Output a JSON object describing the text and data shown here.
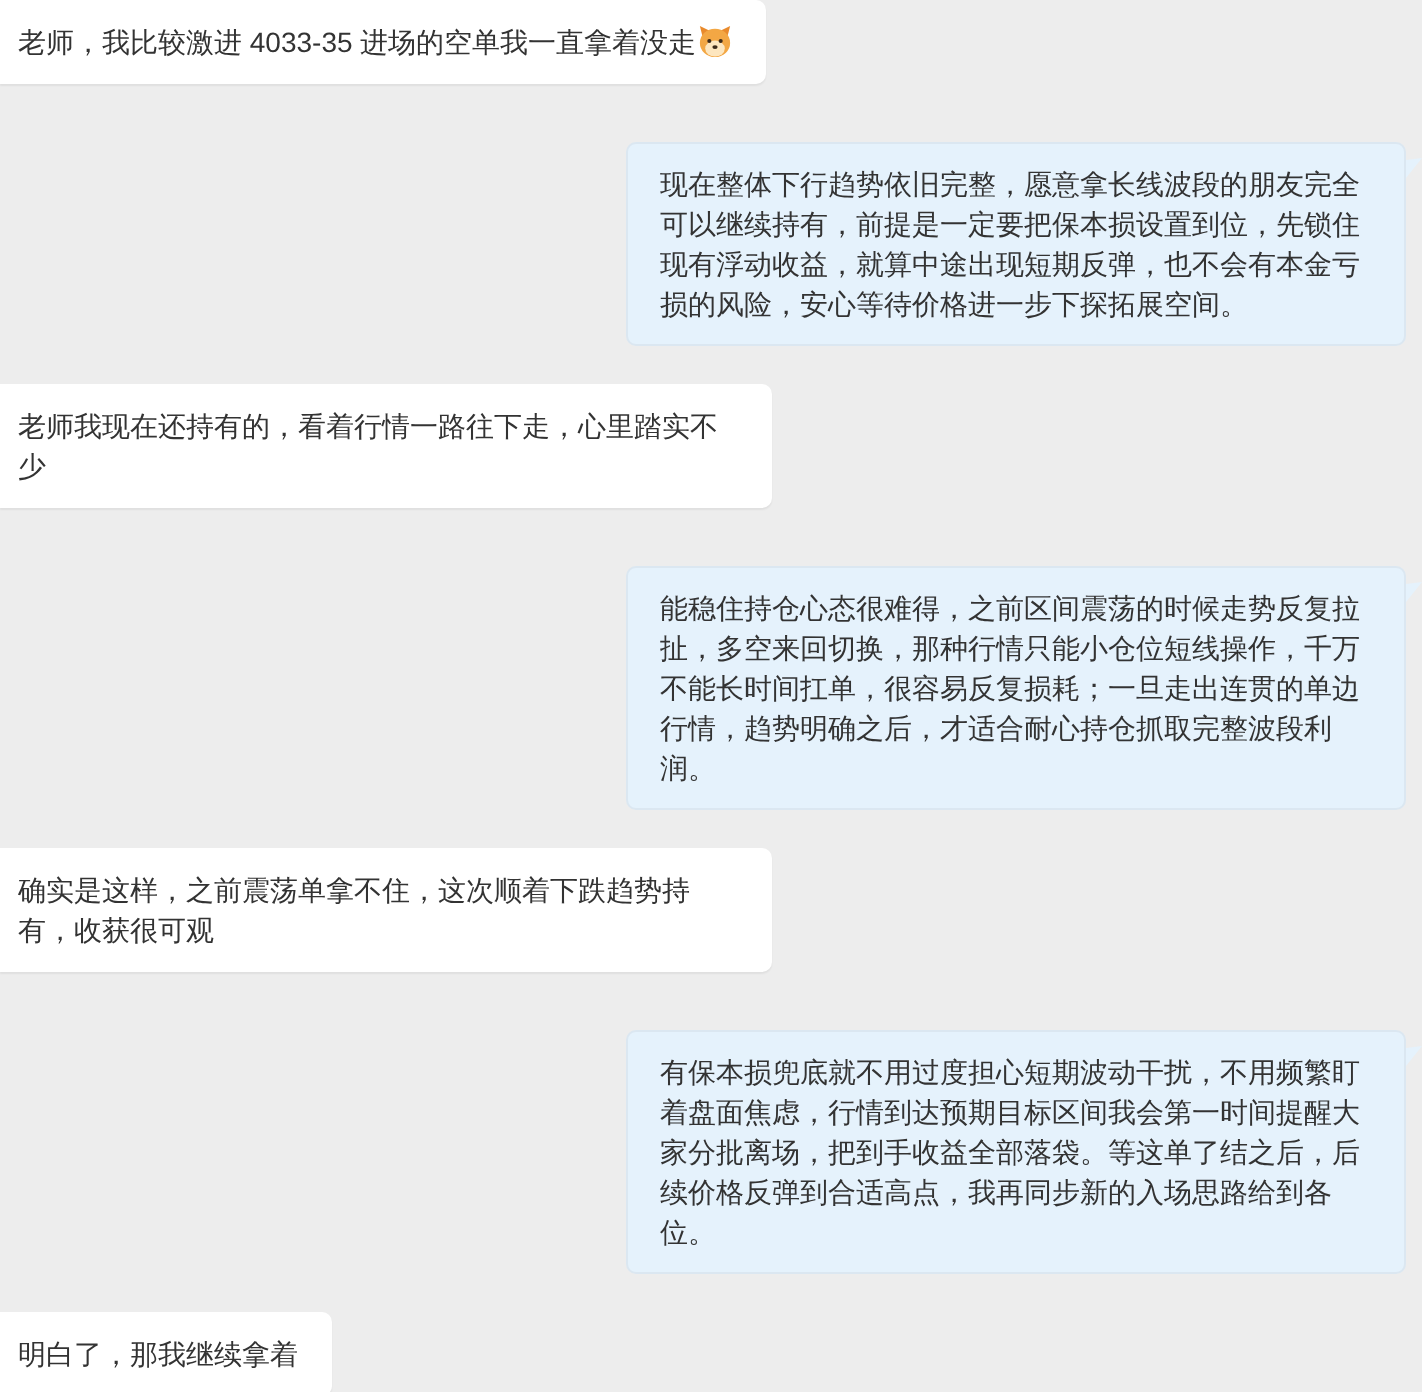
{
  "messages": [
    {
      "kind": "incoming",
      "text": "老师，我比较激进 4033-35 进场的空单我一直拿着没走",
      "has_emoji": true
    },
    {
      "kind": "outgoing",
      "text": "现在整体下行趋势依旧完整，愿意拿长线波段的朋友完全可以继续持有，前提是一定要把保本损设置到位，先锁住现有浮动收益，就算中途出现短期反弹，也不会有本金亏损的风险，安心等待价格进一步下探拓展空间。"
    },
    {
      "kind": "incoming",
      "text": "老师我现在还持有的，看着行情一路往下走，心里踏实不少"
    },
    {
      "kind": "outgoing",
      "text": "能稳住持仓心态很难得，之前区间震荡的时候走势反复拉扯，多空来回切换，那种行情只能小仓位短线操作，千万不能长时间扛单，很容易反复损耗；一旦走出连贯的单边行情，趋势明确之后，才适合耐心持仓抓取完整波段利润。"
    },
    {
      "kind": "incoming",
      "text": "确实是这样，之前震荡单拿不住，这次顺着下跌趋势持有，收获很可观"
    },
    {
      "kind": "outgoing",
      "text": "有保本损兜底就不用过度担心短期波动干扰，不用频繁盯着盘面焦虑，行情到达预期目标区间我会第一时间提醒大家分批离场，把到手收益全部落袋。等这单了结之后，后续价格反弹到合适高点，我再同步新的入场思路给到各位。"
    },
    {
      "kind": "incoming",
      "text": "明白了，那我继续拿着"
    }
  ]
}
